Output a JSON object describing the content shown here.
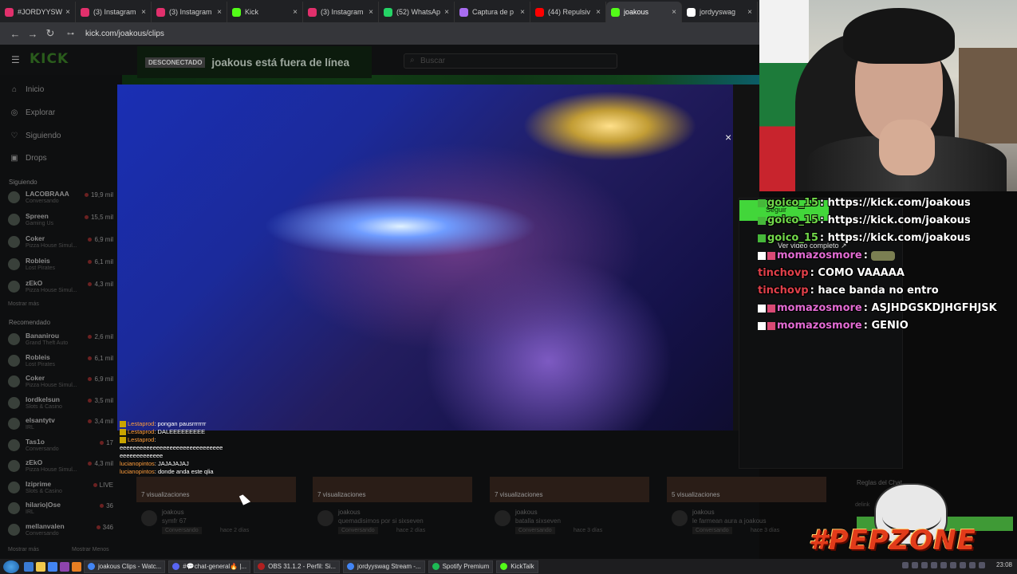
{
  "browser": {
    "tabs": [
      {
        "title": "#JORDYYSW",
        "color": "#e1306c"
      },
      {
        "title": "(3) Instagram",
        "color": "#e1306c"
      },
      {
        "title": "(3) Instagram",
        "color": "#e1306c"
      },
      {
        "title": "Kick",
        "color": "#53fc18"
      },
      {
        "title": "(3) Instagram",
        "color": "#e1306c"
      },
      {
        "title": "(52) WhatsAp",
        "color": "#25d366"
      },
      {
        "title": "Captura de p",
        "color": "#a86cf0"
      },
      {
        "title": "(44) Repulsiv",
        "color": "#ff0000"
      },
      {
        "title": "joakous",
        "color": "#53fc18"
      },
      {
        "title": "jordyyswag",
        "color": "#ffffff"
      }
    ],
    "close_glyph": "×",
    "url": "kick.com/joakous/clips"
  },
  "kick": {
    "logo": "KICK",
    "search_placeholder": "Buscar",
    "nav": [
      {
        "label": "Inicio",
        "icon": "home-icon",
        "glyph": "⌂"
      },
      {
        "label": "Explorar",
        "icon": "compass-icon",
        "glyph": "◎"
      },
      {
        "label": "Siguiendo",
        "icon": "heart-icon",
        "glyph": "♡"
      },
      {
        "label": "Drops",
        "icon": "gift-icon",
        "glyph": "▣"
      }
    ],
    "following_header": "Siguiendo",
    "following": [
      {
        "name": "LACOBRAAA",
        "sub": "Conversando",
        "viewers": "19,9 mil"
      },
      {
        "name": "Spreen",
        "sub": "Gaming Us",
        "viewers": "15,5 mil"
      },
      {
        "name": "Coker",
        "sub": "Pizza House Simul...",
        "viewers": "6,9 mil"
      },
      {
        "name": "Robleis",
        "sub": "Lost Pirates",
        "viewers": "6,1 mil"
      },
      {
        "name": "zEkO",
        "sub": "Pizza House Simul...",
        "viewers": "4,3 mil"
      }
    ],
    "more_following": "Mostrar más",
    "recommended_header": "Recomendado",
    "recommended": [
      {
        "name": "Bananirou",
        "sub": "Grand Theft Auto",
        "viewers": "2,6 mil"
      },
      {
        "name": "Robleis",
        "sub": "Lost Pirates",
        "viewers": "6,1 mil"
      },
      {
        "name": "Coker",
        "sub": "Pizza House Simul...",
        "viewers": "6,9 mil"
      },
      {
        "name": "lordkelsun",
        "sub": "Slots & Casino",
        "viewers": "3,5 mil"
      },
      {
        "name": "elsantytv",
        "sub": "IRL",
        "viewers": "3,4 mil"
      },
      {
        "name": "Tas1o",
        "sub": "Conversando",
        "viewers": "17"
      },
      {
        "name": "zEkO",
        "sub": "Pizza House Simul...",
        "viewers": "4,3 mil"
      },
      {
        "name": "Iziprime",
        "sub": "Slots & Casino",
        "viewers": "LIVE"
      },
      {
        "name": "hilario|Ose",
        "sub": "IRL",
        "viewers": "36"
      },
      {
        "name": "mellanvalen",
        "sub": "Conversando",
        "viewers": "346"
      }
    ],
    "more_recommended": "Mostrar más",
    "less_recommended": "Mostrar Menos",
    "offline_badge": "DESCONECTADO",
    "offline_text": "joakous está fuera de línea",
    "follow_label": "Seguir",
    "full_video": "Ver video completo",
    "clips": [
      {
        "views": "7 visualizaciones",
        "author": "joakous",
        "title": "symfr 67",
        "category": "Conversando",
        "ago": "hace 2 días"
      },
      {
        "views": "7 visualizaciones",
        "author": "joakous",
        "title": "quemadisimos por si sixseven",
        "category": "Conversando",
        "ago": "hace 2 días"
      },
      {
        "views": "7 visualizaciones",
        "author": "joakous",
        "title": "batalla sixseven",
        "category": "Conversando",
        "ago": "hace 3 días"
      },
      {
        "views": "5 visualizaciones",
        "author": "joakous",
        "title": "le farmean aura a joakous",
        "category": "Conversando",
        "ago": "hace 3 días"
      }
    ],
    "rules_title": "Reglas del Chat",
    "rules_line": "delink"
  },
  "video_chat": [
    {
      "user": "Lestaprod",
      "msg": ": pongan pausrrrrrrr",
      "badge": true
    },
    {
      "user": "Lestaprod",
      "msg": ": DALEEEEEEEEE",
      "badge": true
    },
    {
      "user": "Lestaprod",
      "msg": ":",
      "badge": true
    },
    {
      "user": "",
      "msg": "eeeeeeeeeeeeeeeeeeeeeeeeeeeeeee",
      "badge": false
    },
    {
      "user": "",
      "msg": "eeeeeeeeeeeee",
      "badge": false
    },
    {
      "user": "lucianopintos",
      "msg": ": JAJAJAJAJ",
      "badge": false
    },
    {
      "user": "lucianopintos",
      "msg": ": donde anda este qlia",
      "badge": false
    }
  ],
  "stream_chat": [
    {
      "user": "goico_15",
      "cls": "u-goico",
      "badge": "g",
      "msg": "https://kick.com/joakous"
    },
    {
      "user": "goico_15",
      "cls": "u-goico",
      "badge": "g",
      "msg": "https://kick.com/joakous"
    },
    {
      "user": "goico_15",
      "cls": "u-goico",
      "badge": "g",
      "msg": "https://kick.com/joakous"
    },
    {
      "user": "momazosmore",
      "cls": "u-momazos",
      "badge": "wp",
      "msg": "",
      "emote": true
    },
    {
      "user": "tinchovp",
      "cls": "u-tincho",
      "badge": "",
      "msg": "COMO VAAAAA"
    },
    {
      "user": "tinchovp",
      "cls": "u-tincho",
      "badge": "",
      "msg": "hace banda no entro"
    },
    {
      "user": "momazosmore",
      "cls": "u-momazos",
      "badge": "wp",
      "msg": "ASJHDGSKDJHGFHJSK"
    },
    {
      "user": "momazosmore",
      "cls": "u-momazos",
      "badge": "wp",
      "msg": "GENIO"
    }
  ],
  "overlay_text": "#PEPZONE",
  "taskbar": {
    "tasks": [
      {
        "label": "joakous Clips - Watc...",
        "color": "#4285f4"
      },
      {
        "label": "#💬chat-general🔥 |...",
        "color": "#5865f2"
      },
      {
        "label": "OBS 31.1.2 - Perfil: Si...",
        "color": "#b12020"
      },
      {
        "label": "jordyyswag Stream -...",
        "color": "#4285f4"
      },
      {
        "label": "Spotify Premium",
        "color": "#1db954"
      },
      {
        "label": "KickTalk",
        "color": "#53fc18"
      }
    ],
    "clock": "23:08"
  }
}
